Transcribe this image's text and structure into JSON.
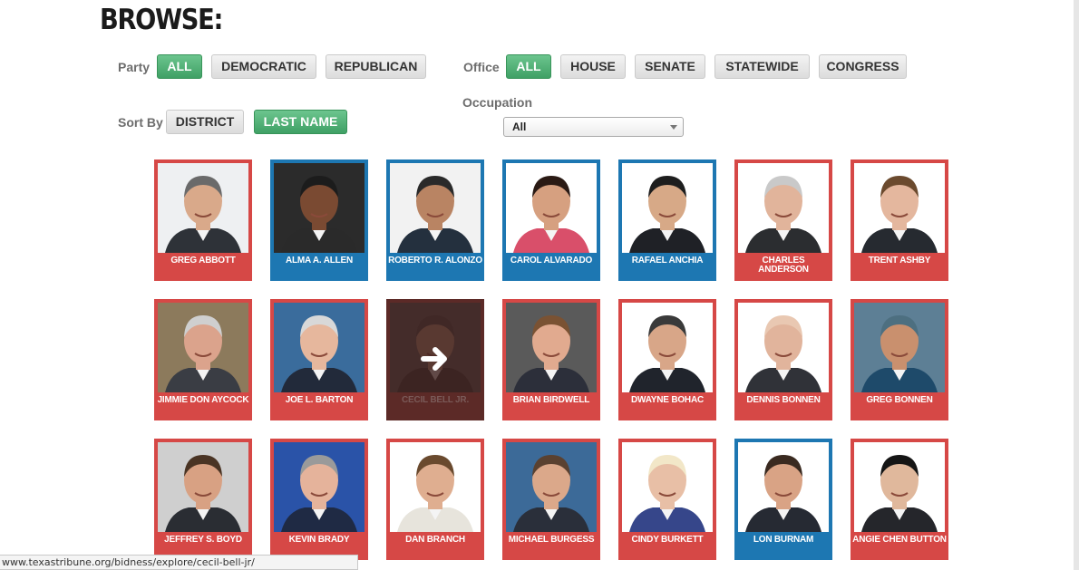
{
  "page": {
    "title": "BROWSE:"
  },
  "filters": {
    "party_label": "Party",
    "party_options": [
      {
        "label": "ALL",
        "active": true
      },
      {
        "label": "DEMOCRATIC",
        "active": false
      },
      {
        "label": "REPUBLICAN",
        "active": false
      }
    ],
    "office_label": "Office",
    "office_options": [
      {
        "label": "ALL",
        "active": true
      },
      {
        "label": "HOUSE",
        "active": false
      },
      {
        "label": "SENATE",
        "active": false
      },
      {
        "label": "STATEWIDE",
        "active": false
      },
      {
        "label": "CONGRESS",
        "active": false
      }
    ],
    "sort_label": "Sort By",
    "sort_options": [
      {
        "label": "DISTRICT",
        "active": false
      },
      {
        "label": "LAST NAME",
        "active": true
      }
    ],
    "occupation_label": "Occupation",
    "occupation_selected": "All"
  },
  "colors": {
    "republican": "#d64846",
    "democrat": "#1d77b2",
    "active_button": "#4caf74"
  },
  "officials": [
    {
      "name": "GREG ABBOTT",
      "party": "R"
    },
    {
      "name": "ALMA A. ALLEN",
      "party": "D"
    },
    {
      "name": "ROBERTO R. ALONZO",
      "party": "D"
    },
    {
      "name": "CAROL ALVARADO",
      "party": "D"
    },
    {
      "name": "RAFAEL ANCHIA",
      "party": "D"
    },
    {
      "name": "CHARLES ANDERSON",
      "party": "R"
    },
    {
      "name": "TRENT ASHBY",
      "party": "R"
    },
    {
      "name": "JIMMIE DON AYCOCK",
      "party": "R"
    },
    {
      "name": "JOE L. BARTON",
      "party": "R"
    },
    {
      "name": "CECIL BELL JR.",
      "party": "R",
      "hovered": true
    },
    {
      "name": "BRIAN BIRDWELL",
      "party": "R"
    },
    {
      "name": "DWAYNE BOHAC",
      "party": "R"
    },
    {
      "name": "DENNIS BONNEN",
      "party": "R"
    },
    {
      "name": "GREG BONNEN",
      "party": "R"
    },
    {
      "name": "JEFFREY S. BOYD",
      "party": "R"
    },
    {
      "name": "KEVIN BRADY",
      "party": "R"
    },
    {
      "name": "DAN BRANCH",
      "party": "R"
    },
    {
      "name": "MICHAEL BURGESS",
      "party": "R"
    },
    {
      "name": "CINDY BURKETT",
      "party": "R"
    },
    {
      "name": "LON BURNAM",
      "party": "D"
    },
    {
      "name": "ANGIE CHEN BUTTON",
      "party": "R"
    }
  ],
  "status_bar": {
    "url": "www.texastribune.org/bidness/explore/cecil-bell-jr/"
  },
  "icons": {
    "hover_arrow": "arrow-right-icon"
  }
}
